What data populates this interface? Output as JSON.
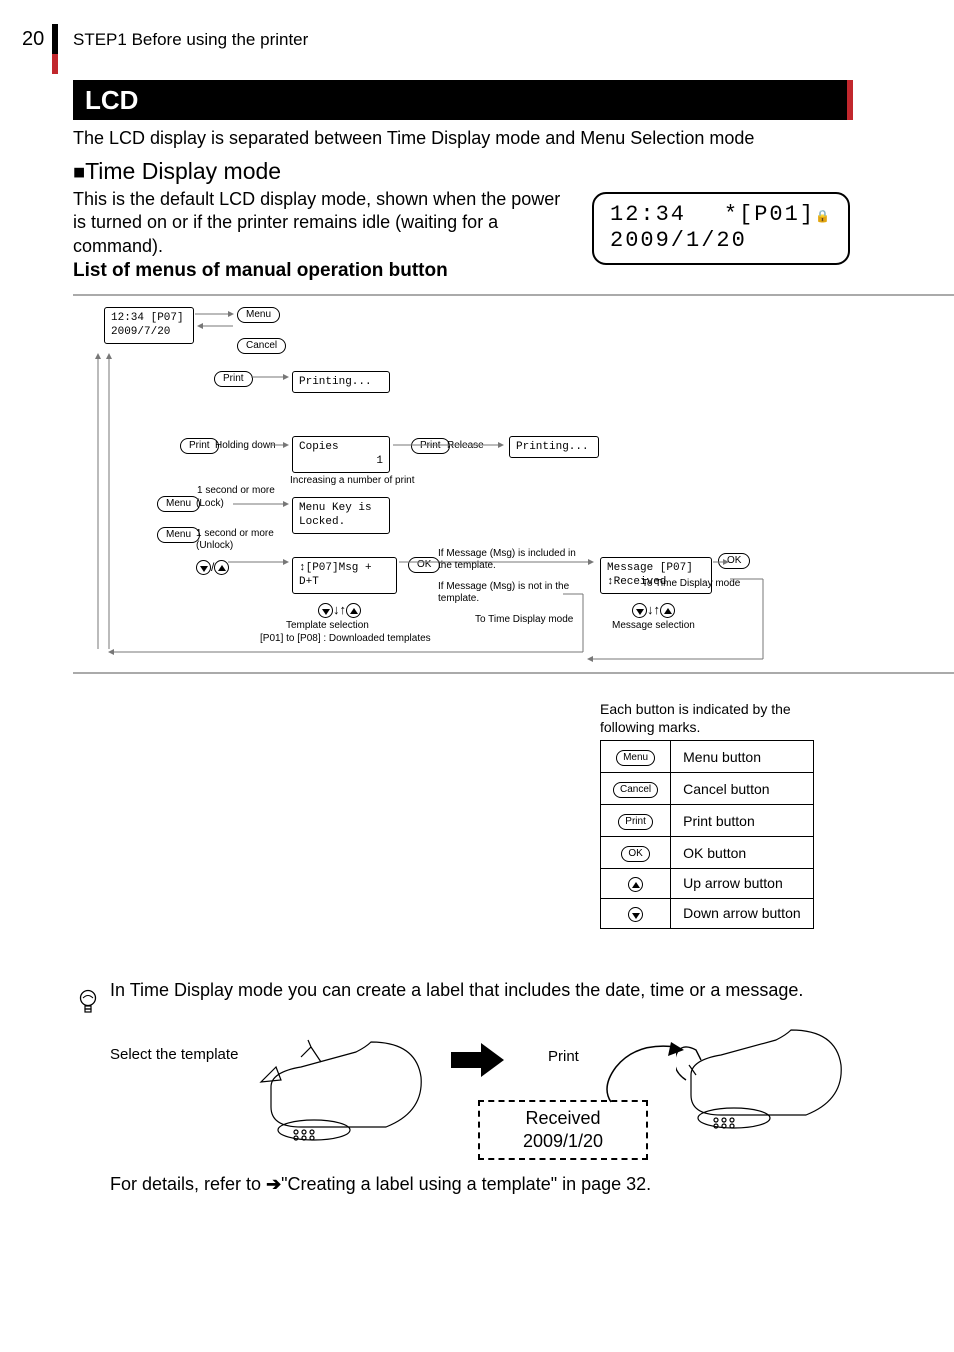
{
  "page": {
    "number": "20",
    "chapter": "STEP1 Before using the printer"
  },
  "section": {
    "title": "LCD",
    "intro": "The LCD display is separated between Time Display mode and Menu Selection mode"
  },
  "time_mode": {
    "heading": "Time Display mode",
    "desc": "This is the default LCD display mode, shown when the power is turned on or if the printer remains idle (waiting for a command).",
    "lcd": {
      "time": "12:34",
      "slot": "*[P01]",
      "date": "2009/1/20"
    }
  },
  "list_heading": "List of menus of manual operation button",
  "diagram": {
    "start": {
      "line1": "12:34   [P07]",
      "line2": "2009/7/20"
    },
    "menu": "Menu",
    "cancel": "Cancel",
    "print": "Print",
    "printing": "Printing...",
    "print_hold": {
      "btn": "Print",
      "label": "Holding down"
    },
    "copies": {
      "line1": "Copies",
      "line2": "1"
    },
    "copies_note": "Increasing a number of print",
    "release": {
      "btn": "Print",
      "label": "Release"
    },
    "printing2": "Printing...",
    "one_sec": "1 second or more",
    "menu_lock": {
      "btn": "Menu",
      "label": "(Lock)"
    },
    "menu_locked": {
      "line1": "Menu Key is",
      "line2": "Locked."
    },
    "menu_unlock": {
      "btn": "Menu",
      "label1": "1 second or more",
      "label2": "(Unlock)"
    },
    "down_up": "▼/▲",
    "template": {
      "line1": "↕[P07]Msg + D+T"
    },
    "template_notes": {
      "l1": "Template selection",
      "l2": "[P01] to [P08] : Downloaded templates"
    },
    "ok": "OK",
    "msg_in": "If Message (Msg) is included in the template.",
    "msg_not": "If Message (Msg) is not in the template.",
    "to_time": "To Time Display mode",
    "msg_sel": {
      "line1": "Message  [P07]",
      "line2": "↕Received"
    },
    "msg_sel_note": "Message selection",
    "ok2": "OK",
    "to_time2": "To Time Display mode"
  },
  "legend": {
    "intro": "Each button is indicated by the following marks.",
    "rows": [
      {
        "icon": "Menu",
        "label": "Menu button"
      },
      {
        "icon": "Cancel",
        "label": "Cancel button"
      },
      {
        "icon": "Print",
        "label": "Print button"
      },
      {
        "icon": "OK",
        "label": "OK button"
      },
      {
        "icon": "up",
        "label": "Up arrow button"
      },
      {
        "icon": "down",
        "label": "Down arrow button"
      }
    ]
  },
  "tip": "In Time Display mode you can create a label that includes the date, time or a message.",
  "bottom": {
    "select": "Select the template",
    "print": "Print",
    "received": {
      "l1": "Received",
      "l2": "2009/1/20"
    },
    "footer_pre": "For details, refer to ",
    "footer_link": "\"Creating a label using a template\" in page 32."
  }
}
